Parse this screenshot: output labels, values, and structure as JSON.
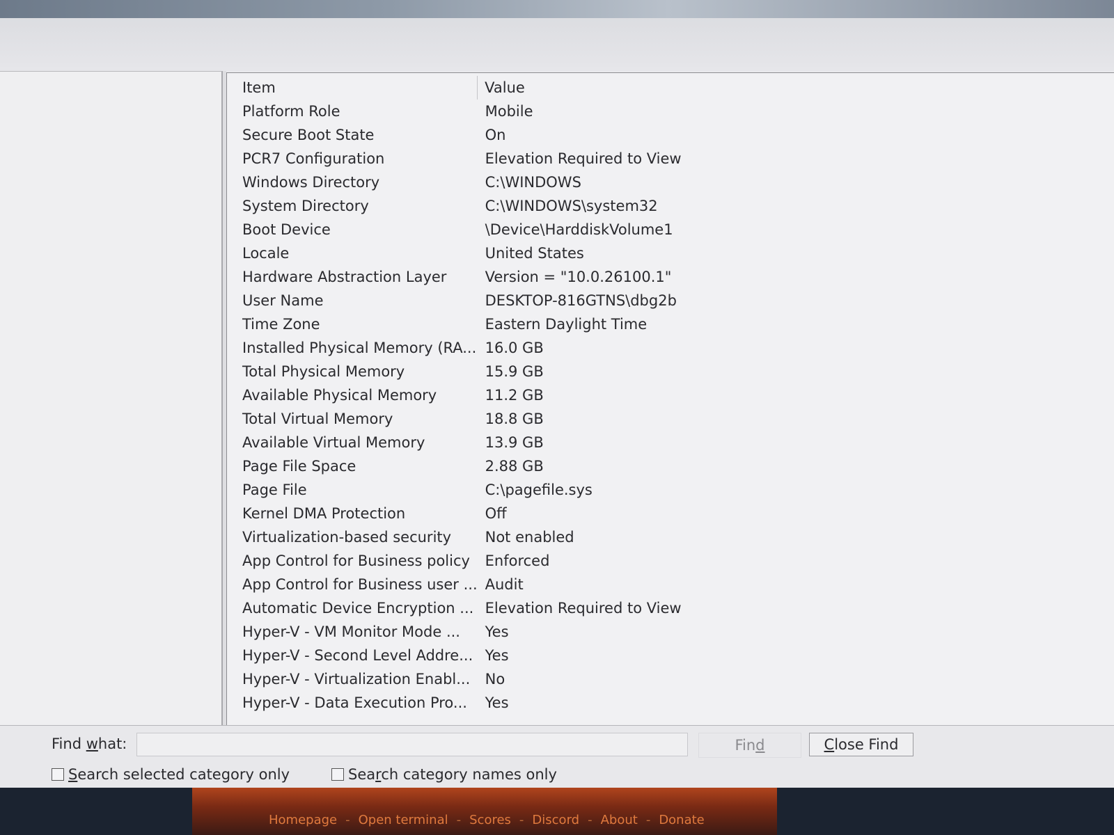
{
  "table": {
    "headers": {
      "item": "Item",
      "value": "Value"
    },
    "rows": [
      {
        "item": "Platform Role",
        "value": "Mobile"
      },
      {
        "item": "Secure Boot State",
        "value": "On"
      },
      {
        "item": "PCR7 Configuration",
        "value": "Elevation Required to View"
      },
      {
        "item": "Windows Directory",
        "value": "C:\\WINDOWS"
      },
      {
        "item": "System Directory",
        "value": "C:\\WINDOWS\\system32"
      },
      {
        "item": "Boot Device",
        "value": "\\Device\\HarddiskVolume1"
      },
      {
        "item": "Locale",
        "value": "United States"
      },
      {
        "item": "Hardware Abstraction Layer",
        "value": "Version = \"10.0.26100.1\""
      },
      {
        "item": "User Name",
        "value": "DESKTOP-816GTNS\\dbg2b"
      },
      {
        "item": "Time Zone",
        "value": "Eastern Daylight Time"
      },
      {
        "item": "Installed Physical Memory (RA...",
        "value": "16.0 GB"
      },
      {
        "item": "Total Physical Memory",
        "value": "15.9 GB"
      },
      {
        "item": "Available Physical Memory",
        "value": "11.2 GB"
      },
      {
        "item": "Total Virtual Memory",
        "value": "18.8 GB"
      },
      {
        "item": "Available Virtual Memory",
        "value": "13.9 GB"
      },
      {
        "item": "Page File Space",
        "value": "2.88 GB"
      },
      {
        "item": "Page File",
        "value": "C:\\pagefile.sys"
      },
      {
        "item": "Kernel DMA Protection",
        "value": "Off"
      },
      {
        "item": "Virtualization-based security",
        "value": "Not enabled"
      },
      {
        "item": "App Control for Business policy",
        "value": "Enforced"
      },
      {
        "item": "App Control for Business user ...",
        "value": "Audit"
      },
      {
        "item": "Automatic Device Encryption ...",
        "value": "Elevation Required to View"
      },
      {
        "item": "Hyper-V - VM Monitor Mode ...",
        "value": "Yes"
      },
      {
        "item": "Hyper-V - Second Level Addre...",
        "value": "Yes"
      },
      {
        "item": "Hyper-V - Virtualization Enabl...",
        "value": "No"
      },
      {
        "item": "Hyper-V - Data Execution Pro...",
        "value": "Yes"
      }
    ]
  },
  "find": {
    "label_pre": "Find ",
    "label_u": "w",
    "label_post": "hat:",
    "input_value": "",
    "find_button_pre": "Fin",
    "find_button_u": "d",
    "find_button_post": "",
    "close_button_pre": "",
    "close_button_u": "C",
    "close_button_post": "lose Find",
    "checkbox_selected_pre": "",
    "checkbox_selected_u": "S",
    "checkbox_selected_post": "earch selected category only",
    "checkbox_names_pre": "Sea",
    "checkbox_names_u": "r",
    "checkbox_names_post": "ch category names only",
    "checkbox_selected_checked": false,
    "checkbox_names_checked": false
  },
  "footer": {
    "links": [
      "Homepage",
      "Open terminal",
      "Scores",
      "Discord",
      "About",
      "Donate"
    ],
    "separator": "-",
    "link_color": "#e07a3e"
  }
}
